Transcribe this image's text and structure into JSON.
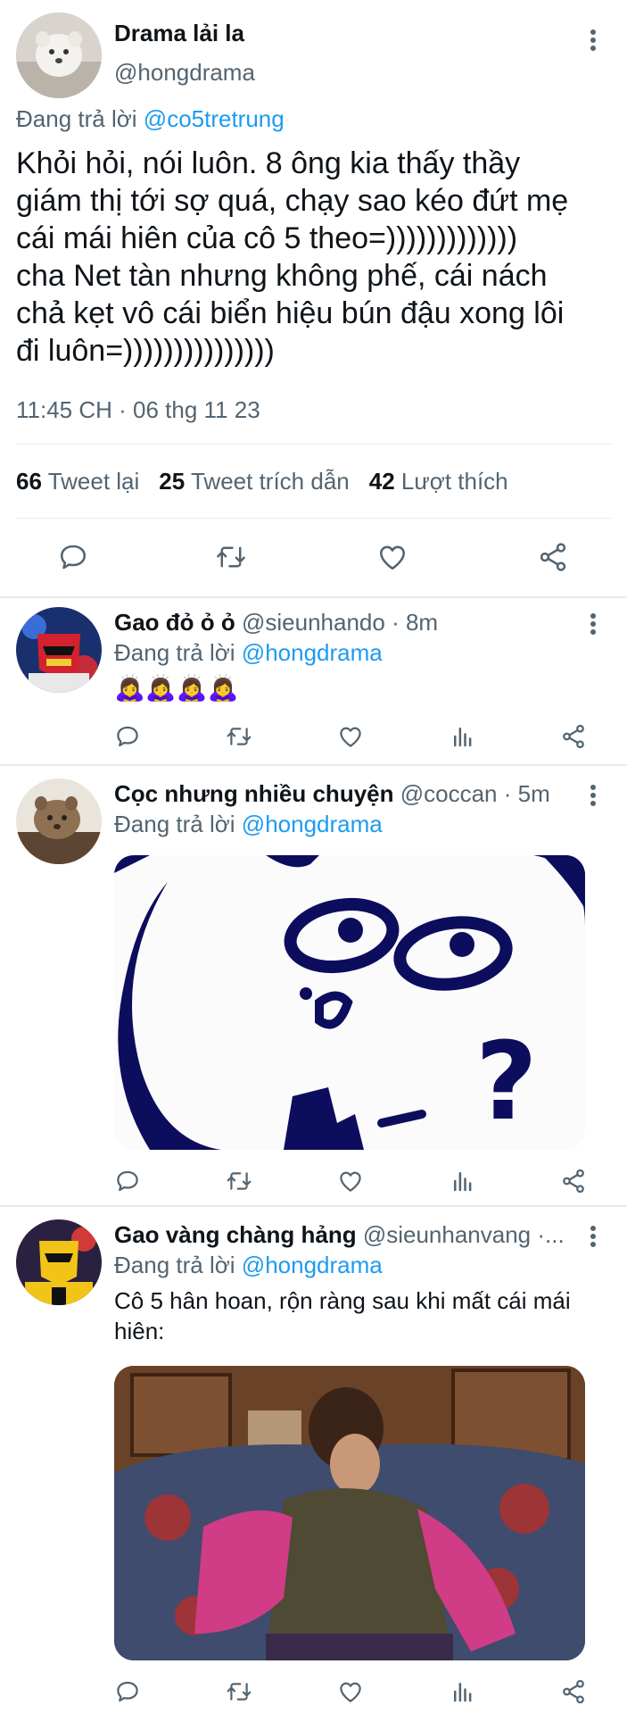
{
  "main_tweet": {
    "author_name": "Drama lải la",
    "author_handle": "@hongdrama",
    "replying_prefix": "Đang trả lời",
    "replying_to": "@co5tretrung",
    "text": "Khỏi hỏi, nói luôn. 8 ông kia thấy thầy\ngiám thị tới sợ quá, chạy sao kéo đứt mẹ\ncái mái hiên của cô 5 theo=)))))))))))))\ncha Net tàn nhưng không phế, cái nách\nchả kẹt vô cái biển hiệu bún đậu xong lôi\nđi luôn=)))))))))))))))",
    "timestamp": "11:45 CH · 06 thg 11 23",
    "stats": {
      "retweets_count": "66",
      "retweets_label": "Tweet lại",
      "quotes_count": "25",
      "quotes_label": "Tweet trích dẫn",
      "likes_count": "42",
      "likes_label": "Lượt thích"
    }
  },
  "replies": [
    {
      "name": "Gao đỏ ỏ ỏ",
      "handle": "@sieunhando",
      "time": "· 8m",
      "replying_prefix": "Đang trả lời",
      "replying_to": "@hongdrama",
      "text": "🙇‍♀️🙇‍♀️🙇‍♀️🙇‍♀️"
    },
    {
      "name": "Cọc nhưng nhiều chuyện",
      "handle": "@coccan",
      "time": "· 5m",
      "replying_prefix": "Đang trả lời",
      "replying_to": "@hongdrama",
      "media_text": "?"
    },
    {
      "name": "Gao vàng chàng hảng",
      "handle": "@sieunhanvang",
      "time": "·...",
      "replying_prefix": "Đang trả lời",
      "replying_to": "@hongdrama",
      "text": "Cô 5 hân hoan, rộn ràng sau khi mất cái mái hiên:"
    }
  ],
  "icons": [
    "reply-icon",
    "retweet-icon",
    "like-icon",
    "share-icon",
    "views-icon",
    "more-icon"
  ],
  "colors": {
    "text": "#0f1419",
    "muted": "#536471",
    "link": "#1d9bf0",
    "divider": "#e7e9ea"
  }
}
